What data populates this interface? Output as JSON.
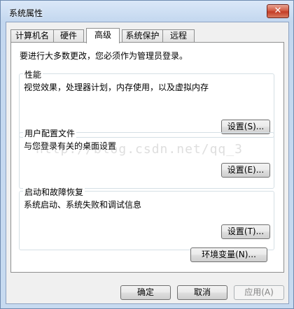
{
  "window": {
    "title": "系统属性",
    "close_symbol": "✕"
  },
  "tabs": [
    {
      "label": "计算机名",
      "active": false
    },
    {
      "label": "硬件",
      "active": false
    },
    {
      "label": "高级",
      "active": true
    },
    {
      "label": "系统保护",
      "active": false
    },
    {
      "label": "远程",
      "active": false
    }
  ],
  "advanced": {
    "intro": "要进行大多数更改，您必须作为管理员登录。",
    "performance": {
      "title": "性能",
      "desc": "视觉效果，处理器计划，内存使用，以及虚拟内存",
      "button": "设置(S)..."
    },
    "profiles": {
      "title": "用户配置文件",
      "desc": "与您登录有关的桌面设置",
      "button": "设置(E)..."
    },
    "startup": {
      "title": "启动和故障恢复",
      "desc": "系统启动、系统失败和调试信息",
      "button": "设置(T)..."
    },
    "env_button": "环境变量(N)..."
  },
  "footer": {
    "ok": "确定",
    "cancel": "取消",
    "apply": "应用(A)"
  },
  "watermark": "http://blog.csdn.net/qq_3"
}
